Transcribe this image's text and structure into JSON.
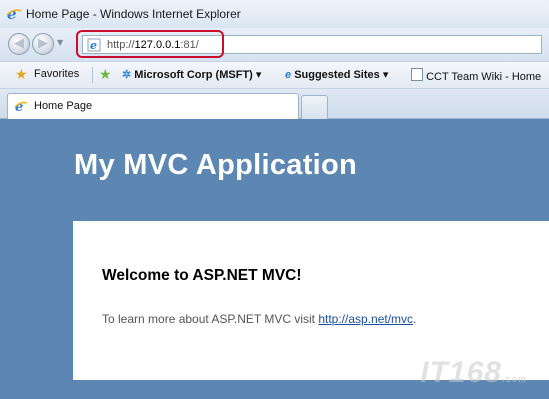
{
  "window": {
    "title": "Home Page - Windows Internet Explorer"
  },
  "nav": {
    "back_icon": "back-arrow-icon",
    "forward_icon": "forward-arrow-icon"
  },
  "address": {
    "prefix": "http://",
    "host": "127.0.0.1",
    "suffix": ":81/"
  },
  "favorites": {
    "favorites_label": "Favorites",
    "items": [
      {
        "label": "Microsoft Corp (MSFT)",
        "icon": "msn-icon"
      },
      {
        "label": "Suggested Sites",
        "icon": "ie-icon"
      },
      {
        "label": "CCT Team Wiki - Home",
        "icon": "page-icon"
      }
    ]
  },
  "tabs": [
    {
      "label": "Home Page"
    }
  ],
  "page": {
    "app_title": "My MVC Application",
    "welcome": "Welcome to ASP.NET MVC!",
    "learn_text": "To learn more about ASP.NET MVC visit ",
    "learn_link": "http://asp.net/mvc",
    "learn_end": "."
  },
  "watermark": {
    "text": "IT168",
    "suffix": ".com"
  },
  "colors": {
    "page_bg": "#5c87b2",
    "panel_bg": "#ffffff",
    "highlight": "#c8102e",
    "link": "#1a4fa0"
  }
}
